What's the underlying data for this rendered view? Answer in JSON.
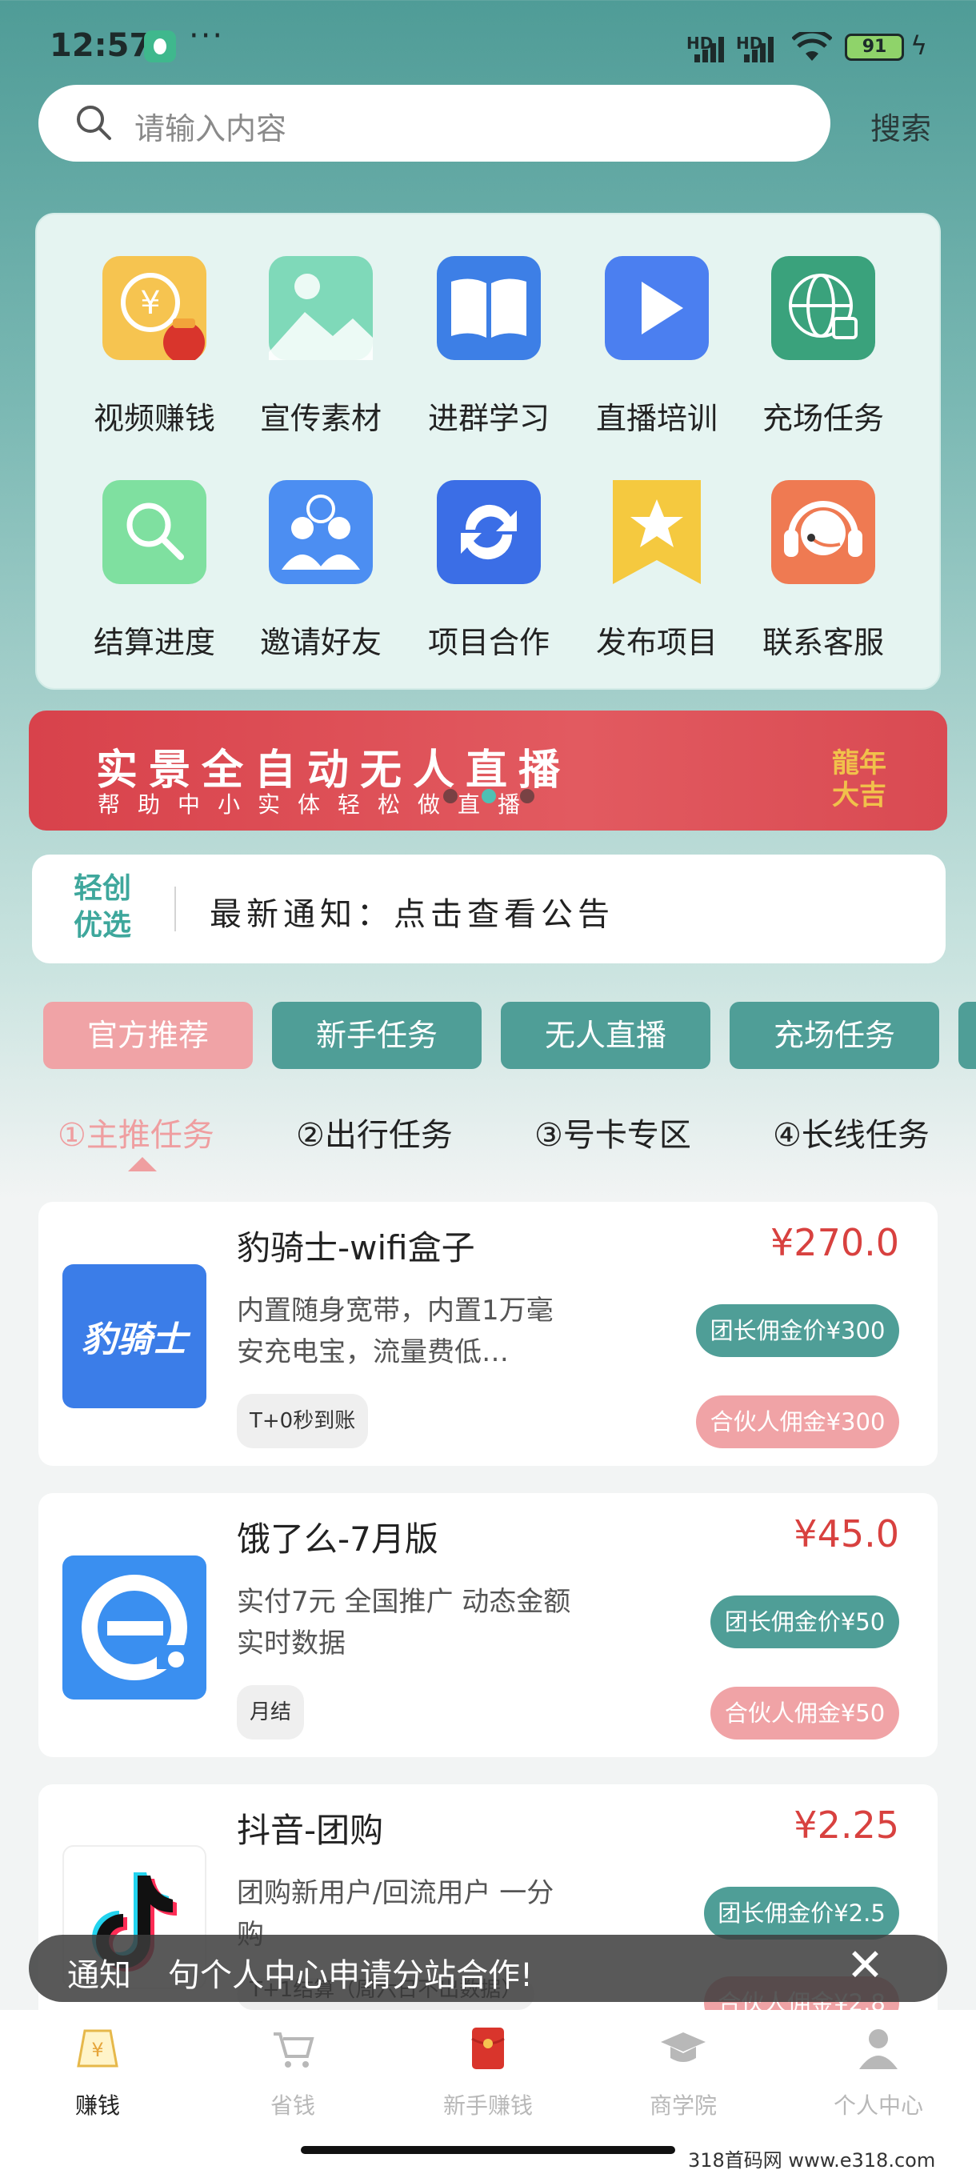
{
  "status_bar": {
    "time": "12:57",
    "more": "···",
    "sig1": "HD",
    "sig2": "HD",
    "battery": "91"
  },
  "search": {
    "placeholder": "请输入内容",
    "button": "搜索"
  },
  "grid": {
    "items": [
      {
        "label": "视频赚钱",
        "icon": "video-earn-icon"
      },
      {
        "label": "宣传素材",
        "icon": "image-icon"
      },
      {
        "label": "进群学习",
        "icon": "book-icon"
      },
      {
        "label": "直播培训",
        "icon": "play-icon"
      },
      {
        "label": "充场任务",
        "icon": "globe-lock-icon"
      },
      {
        "label": "结算进度",
        "icon": "magnifier-icon"
      },
      {
        "label": "邀请好友",
        "icon": "users-icon"
      },
      {
        "label": "项目合作",
        "icon": "sync-icon"
      },
      {
        "label": "发布项目",
        "icon": "star-flag-icon"
      },
      {
        "label": "联系客服",
        "icon": "headset-icon"
      }
    ]
  },
  "banner": {
    "title": "实景全自动无人直播",
    "subtitle": "帮助中小实体轻松做直播",
    "deco": "龍年大吉"
  },
  "notice": {
    "logo": "轻创优选",
    "logo_line1": "轻创",
    "logo_line2": "优选",
    "text": "最新通知：点击查看公告"
  },
  "category_tabs": [
    "官方推荐",
    "新手任务",
    "无人直播",
    "充场任务"
  ],
  "sub_tabs": [
    "①主推任务",
    "②出行任务",
    "③号卡专区",
    "④长线任务"
  ],
  "tasks": [
    {
      "title": "豹骑士-wifi盒子",
      "desc": "内置随身宽带，内置1万毫安充电宝，流量费低…",
      "price": "¥270.0",
      "settle": "T+0秒到账",
      "leader": "团长佣金价¥300",
      "partner": "合伙人佣金¥300",
      "logo_text": "豹骑士",
      "logo_color": "#3b7de8"
    },
    {
      "title": "饿了么-7月版",
      "desc": "实付7元 全国推广 动态金额 实时数据",
      "price": "¥45.0",
      "settle": "月结",
      "leader": "团长佣金价¥50",
      "partner": "合伙人佣金¥50",
      "logo_text": "e",
      "logo_color": "#3a8ff0"
    },
    {
      "title": "抖音-团购",
      "desc": "团购新用户/回流用户 一分购",
      "price": "¥2.25",
      "settle": "T+1结算（周六日不出数据）",
      "leader": "团长佣金价¥2.5",
      "partner": "合伙人佣金¥2.8",
      "logo_text": "",
      "logo_color": "#111111"
    }
  ],
  "toast": {
    "label": "通知",
    "text": "句个人中心申请分站合作!",
    "close": "✕"
  },
  "bottom_nav": [
    {
      "label": "赚钱",
      "icon": "earn-icon",
      "active": true
    },
    {
      "label": "省钱",
      "icon": "cart-icon",
      "active": false
    },
    {
      "label": "新手赚钱",
      "icon": "red-envelope-icon",
      "active": false
    },
    {
      "label": "商学院",
      "icon": "graduation-cap-icon",
      "active": false
    },
    {
      "label": "个人中心",
      "icon": "person-icon",
      "active": false
    }
  ],
  "watermark": "318首码网 www.e318.com",
  "colors": {
    "teal": "#4f9e97",
    "pink": "#f0a3a6",
    "price_red": "#d8413f",
    "banner_red": "#d8424b"
  }
}
